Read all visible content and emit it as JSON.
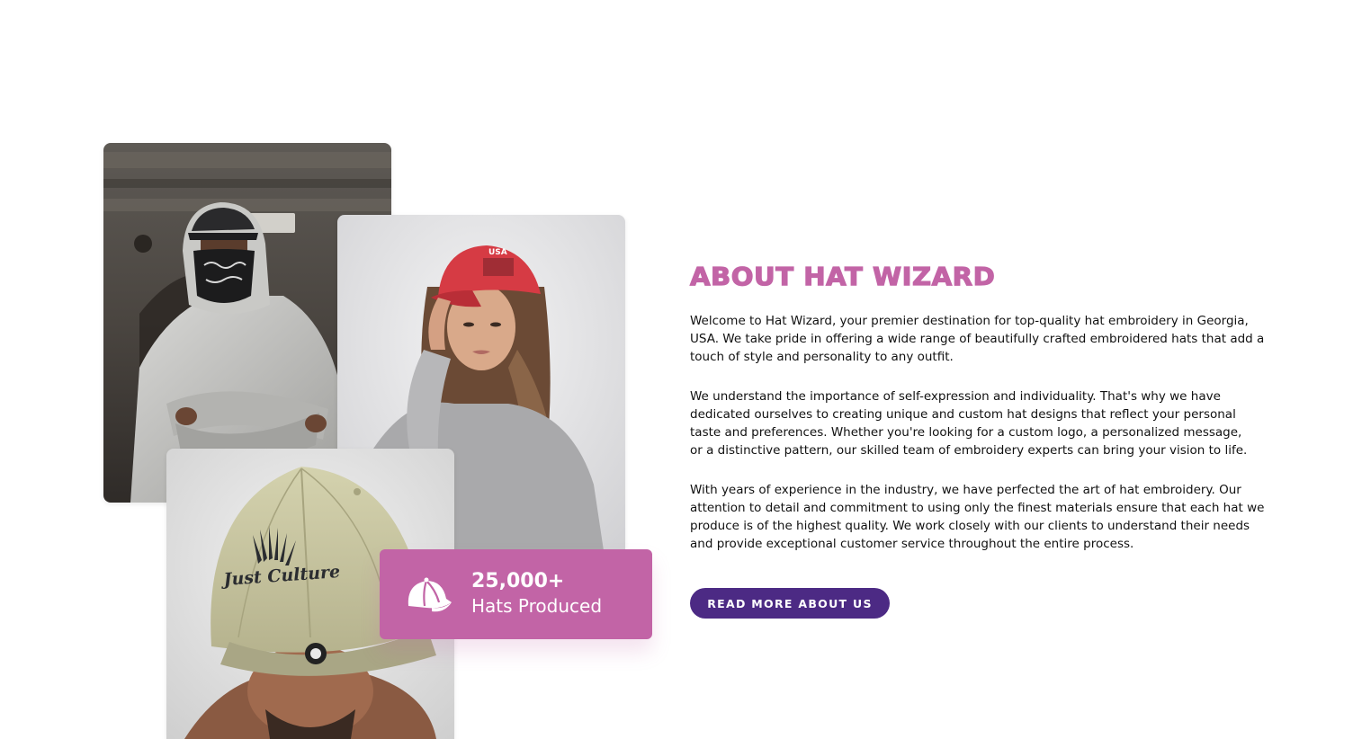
{
  "collage": {
    "photo_hoodie": {
      "alt": "man in hoodie with bandana"
    },
    "photo_redcap": {
      "alt": "woman wearing red USA cap"
    },
    "photo_greencap": {
      "alt": "man wearing Just Culture cap"
    }
  },
  "stat": {
    "icon": "cap-icon",
    "number": "25,000+",
    "label": "Hats Produced"
  },
  "about": {
    "title": "About Hat Wizard",
    "paragraphs": [
      "Welcome to Hat Wizard, your premier destination for top-quality hat embroidery in Georgia, USA. We take pride in offering a wide range of beautifully crafted embroidered hats that add a touch of style and personality to any outfit.",
      "We understand the importance of self-expression and individuality. That's why we have dedicated ourselves to creating unique and custom hat designs that reflect your personal taste and preferences. Whether you're looking for a custom logo, a personalized message, or a distinctive pattern, our skilled team of embroidery experts can bring your vision to life.",
      "With years of experience in the industry, we have perfected the art of hat embroidery. Our attention to detail and commitment to using only the finest materials ensure that each hat we produce is of the highest quality. We work closely with our clients to understand their needs and provide exceptional customer service throughout the entire process."
    ],
    "button_label": "Read More About Us"
  },
  "colors": {
    "accent_pink": "#c264a6",
    "button_purple": "#4c2a84",
    "text": "#111111",
    "background": "#ffffff"
  }
}
